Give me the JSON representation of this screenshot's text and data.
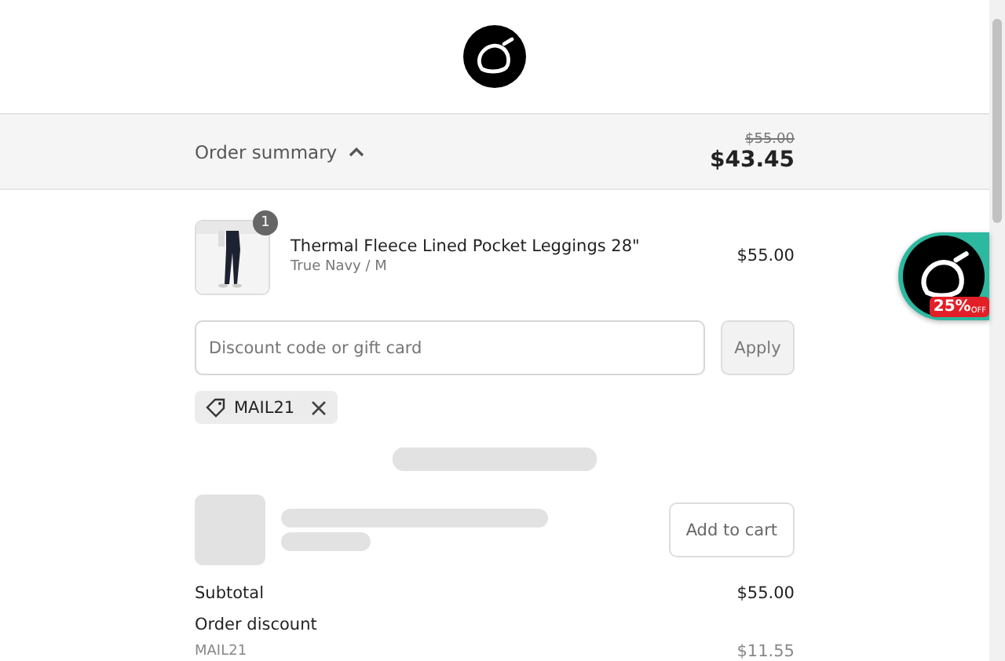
{
  "summary": {
    "label": "Order summary",
    "expanded": true,
    "original_price": "$55.00",
    "total": "$43.45"
  },
  "items": [
    {
      "name": "Thermal Fleece Lined Pocket Leggings 28\"",
      "variant": "True Navy / M",
      "price": "$55.00",
      "quantity": "1"
    }
  ],
  "discount": {
    "placeholder": "Discount code or gift card",
    "button": "Apply"
  },
  "applied_codes": [
    {
      "code": "MAIL21"
    }
  ],
  "recommendation": {
    "button": "Add to cart"
  },
  "totals": [
    {
      "label": "Subtotal",
      "value": "$55.00"
    },
    {
      "label": "Order discount"
    }
  ],
  "discount_line": {
    "code": "MAIL21",
    "value": "$11.55"
  },
  "promo_badge": {
    "percent": "25%",
    "suffix": "OFF"
  }
}
